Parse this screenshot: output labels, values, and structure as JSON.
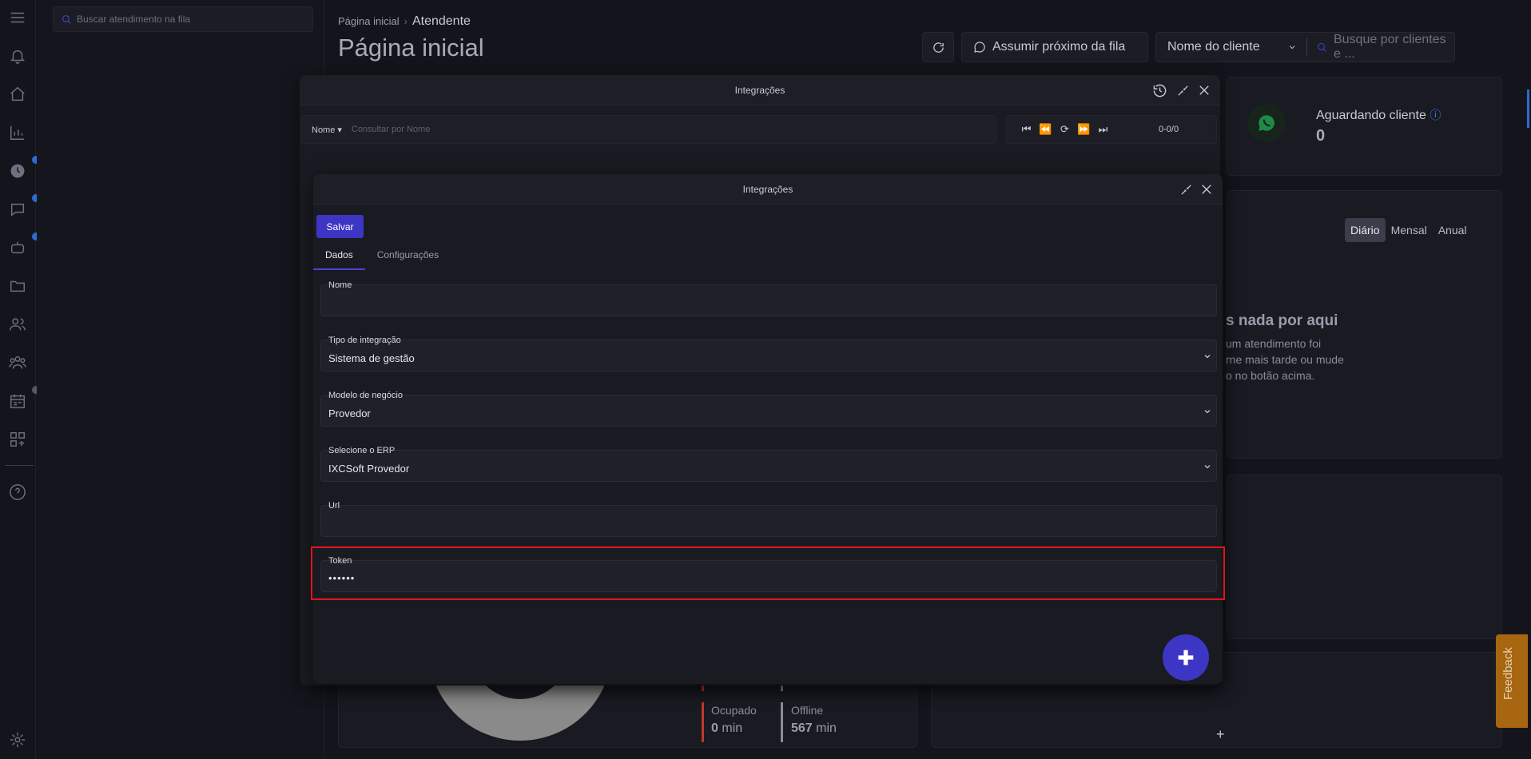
{
  "sidebar": {
    "search_placeholder": "Buscar atendimento na fila",
    "icons": [
      "menu-icon",
      "bell-icon",
      "home-icon",
      "chart-icon",
      "clock-icon",
      "chat-icon",
      "robot-icon",
      "folder-icon",
      "users-icon",
      "team-icon",
      "calendar-icon",
      "widgets-icon",
      "help-icon",
      "settings-icon"
    ]
  },
  "header": {
    "breadcrumb_root": "Página inicial",
    "breadcrumb_current": "Atendente",
    "title": "Página inicial",
    "next_queue_label": "Assumir próximo da fila",
    "client_select_value": "Nome do cliente",
    "search_placeholder": "Busque por clientes e ..."
  },
  "dashboard": {
    "waiting_label": "Aguardando cliente",
    "waiting_value": "0",
    "period_tabs": [
      "Diário",
      "Mensal",
      "Anual"
    ],
    "empty_title": "s nada por aqui",
    "empty_line1": "um atendimento foi",
    "empty_line2": "rne mais tarde ou mude",
    "empty_line3": "o no botão acima.",
    "stats": [
      {
        "label": "Ocupado",
        "value": "0",
        "unit": "min",
        "color": "#c0392b"
      },
      {
        "label": "Offline",
        "value": "567",
        "unit": "min",
        "color": "#8a8c99"
      }
    ]
  },
  "modal_list": {
    "title": "Integrações",
    "filter_field": "Nome",
    "filter_placeholder": "Consultar por Nome",
    "pager_count": "0-0/0"
  },
  "modal_form": {
    "title": "Integrações",
    "save_label": "Salvar",
    "tabs": [
      "Dados",
      "Configurações"
    ],
    "fields": {
      "nome": {
        "label": "Nome",
        "value": ""
      },
      "tipo": {
        "label": "Tipo de integração",
        "value": "Sistema de gestão"
      },
      "modelo": {
        "label": "Modelo de negócio",
        "value": "Provedor"
      },
      "erp": {
        "label": "Selecione o ERP",
        "value": "IXCSoft Provedor"
      },
      "url": {
        "label": "Url",
        "value": ""
      },
      "token": {
        "label": "Token",
        "value": "••••••"
      }
    }
  },
  "feedback_label": "Feedback",
  "colors": {
    "accent": "#3d36c4",
    "highlight": "#e0151d",
    "feedback": "#a7660f"
  }
}
